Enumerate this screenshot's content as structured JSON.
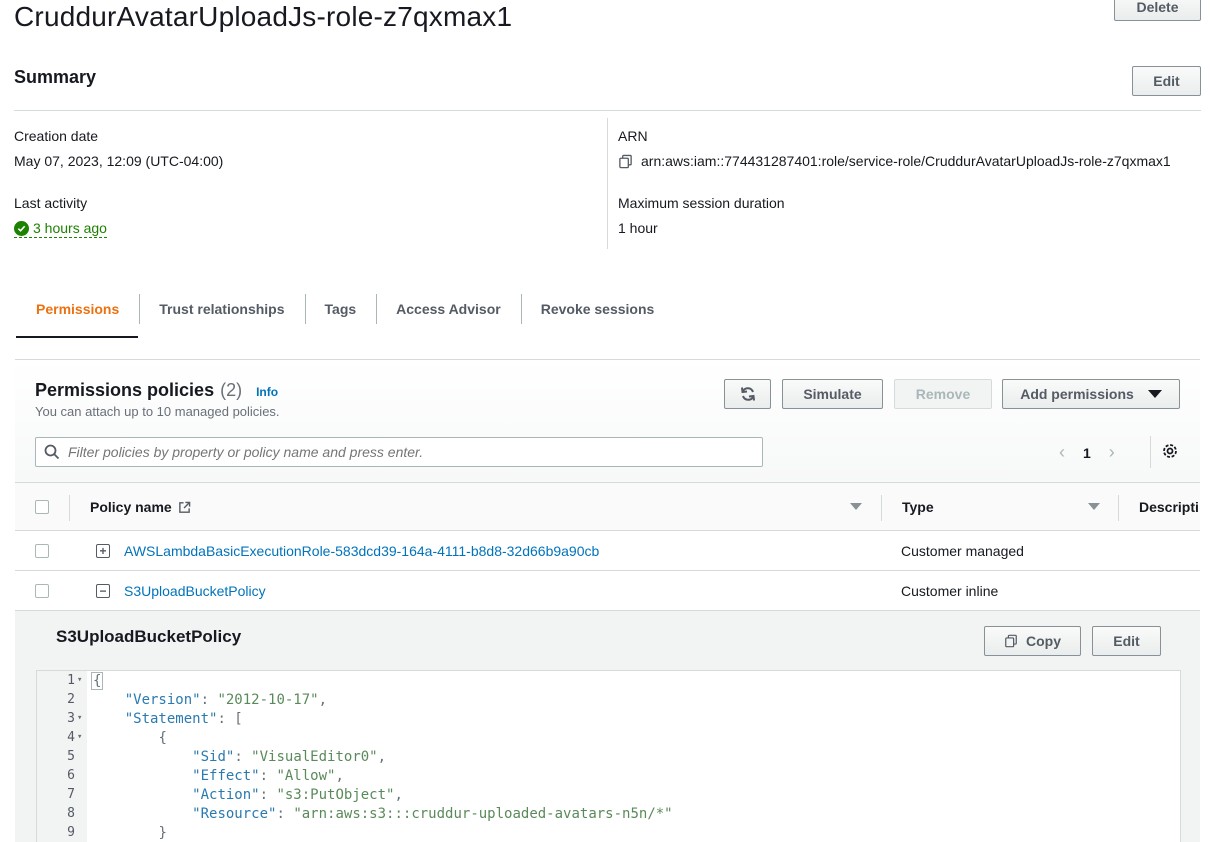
{
  "header": {
    "title": "CruddurAvatarUploadJs-role-z7qxmax1",
    "delete_label": "Delete"
  },
  "summary": {
    "title": "Summary",
    "edit_label": "Edit",
    "creation_date_label": "Creation date",
    "creation_date_value": "May 07, 2023, 12:09 (UTC-04:00)",
    "last_activity_label": "Last activity",
    "last_activity_value": "3 hours ago",
    "arn_label": "ARN",
    "arn_value": "arn:aws:iam::774431287401:role/service-role/CruddurAvatarUploadJs-role-z7qxmax1",
    "max_session_label": "Maximum session duration",
    "max_session_value": "1 hour"
  },
  "tabs": [
    {
      "label": "Permissions",
      "active": true
    },
    {
      "label": "Trust relationships"
    },
    {
      "label": "Tags"
    },
    {
      "label": "Access Advisor"
    },
    {
      "label": "Revoke sessions"
    }
  ],
  "permissions": {
    "title": "Permissions policies",
    "count": "(2)",
    "info_label": "Info",
    "description": "You can attach up to 10 managed policies.",
    "refresh_icon": "refresh-icon",
    "simulate_label": "Simulate",
    "remove_label": "Remove",
    "add_permissions_label": "Add permissions",
    "search_placeholder": "Filter policies by property or policy name and press enter.",
    "page": "1",
    "columns": {
      "policy_name": "Policy name",
      "type": "Type",
      "description": "Descripti"
    },
    "rows": [
      {
        "name": "AWSLambdaBasicExecutionRole-583dcd39-164a-4111-b8d8-32d66b9a90cb",
        "type": "Customer managed",
        "expanded": false
      },
      {
        "name": "S3UploadBucketPolicy",
        "type": "Customer inline",
        "expanded": true
      }
    ]
  },
  "policy_detail": {
    "title": "S3UploadBucketPolicy",
    "copy_label": "Copy",
    "edit_label": "Edit"
  },
  "colors": {
    "accent_tab": "#ec7211",
    "link": "#0073bb",
    "success": "#1d8102"
  }
}
